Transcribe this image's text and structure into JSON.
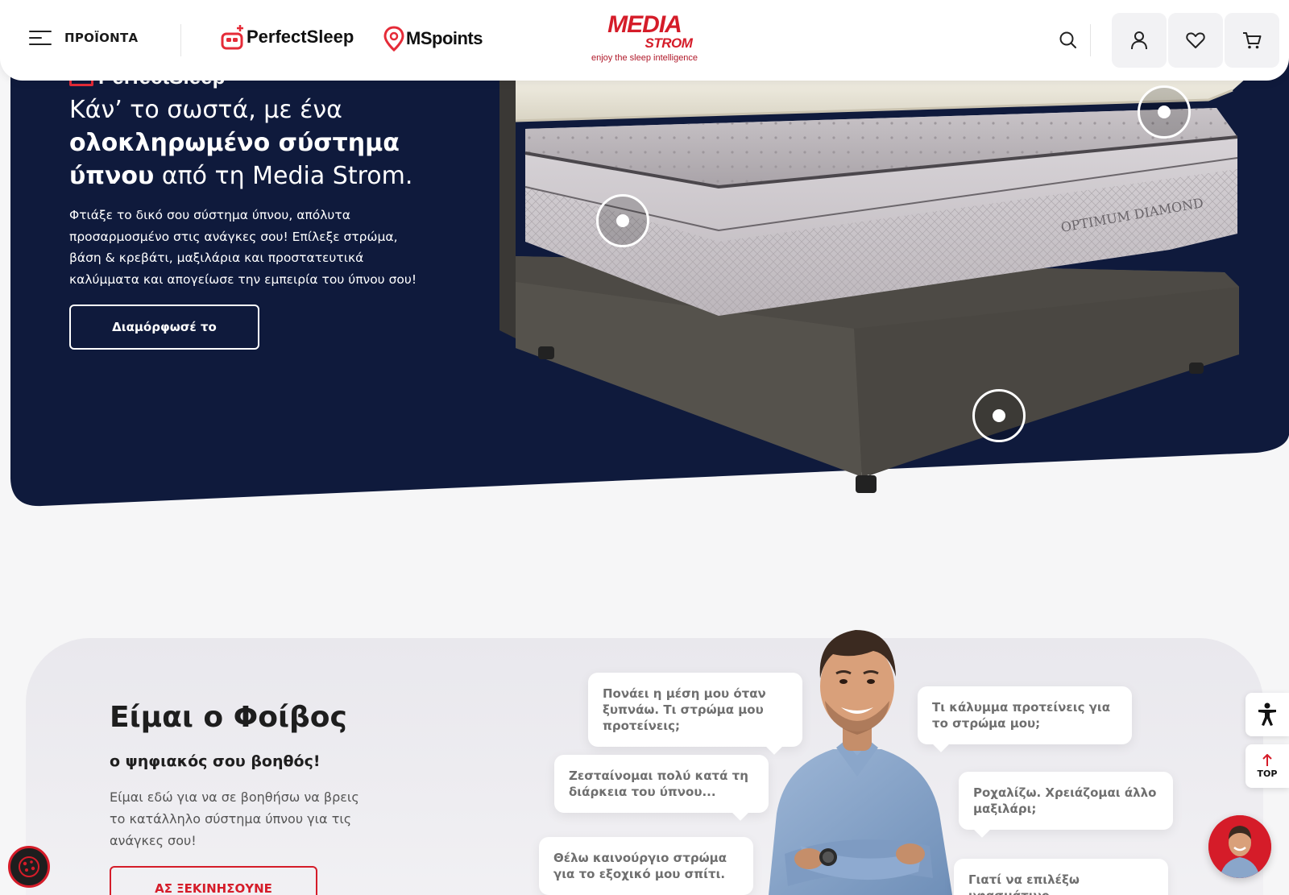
{
  "header": {
    "menu_label": "ΠΡΟΪΟΝΤΑ",
    "perfectsleep_label": "PerfectSleep",
    "mspoints_ms": "MS",
    "mspoints_points": "points",
    "logo_media": "MEDIA",
    "logo_strom": "STROM",
    "logo_tagline": "enjoy the sleep intelligence",
    "icons": [
      "search-icon",
      "user-icon",
      "heart-icon",
      "cart-icon"
    ]
  },
  "hero": {
    "brand": "PerfectSleep",
    "title_line1": "Κάν’ το σωστά, με ένα",
    "title_bold": "ολοκληρωμένο σύστημα ύπνου",
    "title_rest": " από τη Media Strom.",
    "description": "Φτιάξε το δικό σου σύστημα ύπνου, απόλυτα προσαρμοσμένο στις ανάγκες σου! Επίλεξε στρώμα, βάση & κρεβάτι, μαξιλάρια και προστατευτικά καλύμματα και απογείωσε την εμπειρία του ύπνου σου!",
    "button": "Διαμόρφωσέ το",
    "mattress_label": "OPTIMUM DIAMOND",
    "bg_color": "#0f1a3c"
  },
  "assistant": {
    "title": "Είμαι ο Φοίβος",
    "subtitle": "ο ψηφιακός σου βοηθός!",
    "description": "Είμαι εδώ για να σε βοηθήσω να βρεις το κατάλληλο σύστημα ύπνου για τις ανάγκες σου!",
    "button": "ΑΣ ΞΕΚΙΝΗΣΟΥΝΕ",
    "questions": [
      "Πονάει η μέση μου όταν ξυπνάω. Τι στρώμα μου προτείνεις;",
      "Ζεσταίνομαι πολύ κατά τη διάρκεια του ύπνου...",
      "Θέλω καινούργιο στρώμα για το εξοχικό μου σπίτι.",
      "Τι κάλυμμα προτείνεις για το στρώμα μου;",
      "Ροχαλίζω. Χρειάζομαι άλλο μαξιλάρι;",
      "Γιατί να επιλέξω υφασμάτινο"
    ]
  },
  "widgets": {
    "top_label": "TOP"
  },
  "colors": {
    "brand_red": "#d51c29",
    "navy": "#0f1a3c"
  }
}
